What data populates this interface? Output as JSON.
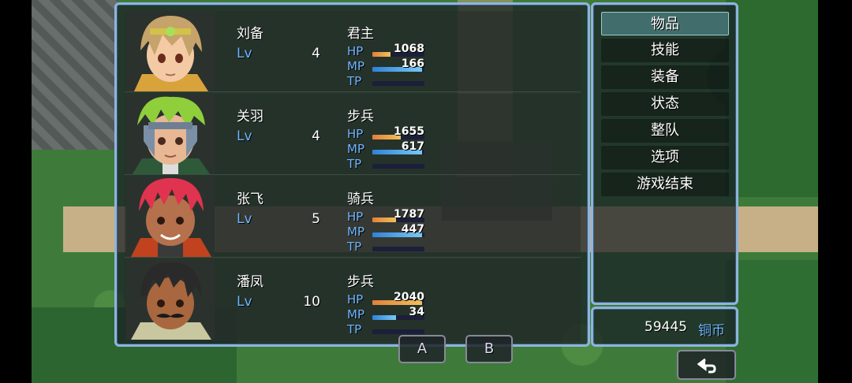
{
  "party": [
    {
      "name": "刘备",
      "lv_label": "Lv",
      "level": "4",
      "class": "君主",
      "hp": "1068",
      "mp": "166",
      "hp_ratio": 0.35,
      "mp_ratio": 0.95,
      "tp_ratio": 0,
      "portrait": "blond-hero-portrait"
    },
    {
      "name": "关羽",
      "lv_label": "Lv",
      "level": "4",
      "class": "步兵",
      "hp": "1655",
      "mp": "617",
      "hp_ratio": 0.55,
      "mp_ratio": 0.95,
      "tp_ratio": 0,
      "portrait": "green-hair-knight-portrait"
    },
    {
      "name": "张飞",
      "lv_label": "Lv",
      "level": "5",
      "class": "骑兵",
      "hp": "1787",
      "mp": "447",
      "hp_ratio": 0.45,
      "mp_ratio": 0.95,
      "tp_ratio": 0,
      "portrait": "red-hair-warrior-portrait"
    },
    {
      "name": "潘凤",
      "lv_label": "Lv",
      "level": "10",
      "class": "步兵",
      "hp": "2040",
      "mp": "34",
      "hp_ratio": 0.95,
      "mp_ratio": 0.45,
      "tp_ratio": 0,
      "portrait": "mustache-soldier-portrait"
    }
  ],
  "labels": {
    "hp": "HP",
    "mp": "MP",
    "tp": "TP"
  },
  "commands": [
    "物品",
    "技能",
    "装备",
    "状态",
    "整队",
    "选项",
    "游戏结束"
  ],
  "selected_command": 0,
  "gold": {
    "amount": "59445",
    "unit": "铜币"
  },
  "buttons": {
    "a": "A",
    "b": "B",
    "back_icon": "return-arrow-icon"
  },
  "colors": {
    "window_border": "#8fb4dc",
    "accent_text": "#6fb6ff",
    "hp_bar": "#f3a04a",
    "mp_bar": "#4aa6ec"
  }
}
